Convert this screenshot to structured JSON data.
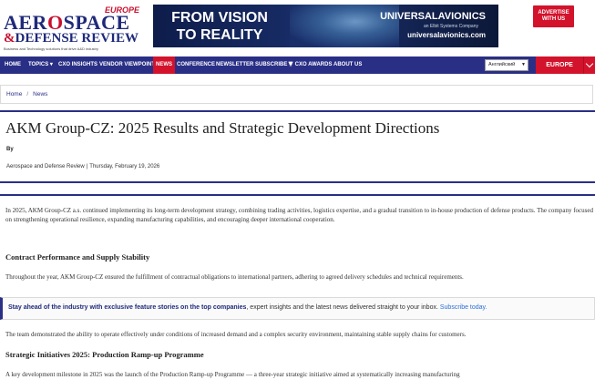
{
  "logo": {
    "edition_badge": "EUROPE",
    "line1_a": "AER",
    "line1_o": "O",
    "line1_b": "SPACE",
    "line2_amp": "&",
    "line2": "DEFENSE REVIEW",
    "tagline": "Business and Technology solutions that drive A&D industry"
  },
  "ad": {
    "headline_1": "FROM VISION",
    "headline_2": "TO REALITY",
    "brand": "UNIVERSALAVIONICS",
    "sub": "an Elbit Systems Company",
    "url": "universalavionics.com"
  },
  "advertise": {
    "line1": "ADVERTISE",
    "line2": "WITH US"
  },
  "nav": {
    "items": [
      "HOME",
      "TOPICS",
      "CXO INSIGHTS",
      "VENDOR VIEWPOINT",
      "NEWS",
      "CONFERENCE",
      "NEWSLETTER",
      "SUBSCRIBE",
      "CXO AWARDS",
      "ABOUT US"
    ],
    "topics_caret": "▾",
    "awards_icon": "trophy-icon",
    "language": "Английский",
    "language_caret": "▼",
    "edition": "EUROPE"
  },
  "breadcrumb": {
    "home": "Home",
    "sep": "/",
    "current": "News"
  },
  "article": {
    "title": "AKM Group-CZ: 2025 Results and Strategic Development Directions",
    "by": "By",
    "source": "Aerospace and Defense Review",
    "meta_sep": "|",
    "date": "Thursday, February 19, 2026",
    "p1": "In 2025, AKM Group-CZ a.s. continued implementing its long-term development strategy, combining trading activities, logistics expertise, and a gradual transition to in-house production of defense products. The company focused on strengthening operational resilience, expanding manufacturing capabilities, and encouraging deeper international cooperation.",
    "h1": "Contract Performance and Supply Stability",
    "p2": "Throughout the year, AKM Group-CZ ensured the fulfillment of contractual obligations to international partners, adhering to agreed delivery schedules and technical requirements.",
    "callout_bold": "Stay ahead of the industry with exclusive feature stories on the top companies",
    "callout_rest": ", expert insights and the latest news delivered straight to your inbox. ",
    "callout_link": "Subscribe today.",
    "p3": "The team demonstrated the ability to operate effectively under conditions of increased demand and a complex security environment, maintaining stable supply chains for customers.",
    "h2": "Strategic Initiatives 2025: Production Ramp-up Programme",
    "p4": "A key development milestone in 2025 was the launch of the Production Ramp-up Programme — a three-year strategic initiative aimed at systematically increasing manufacturing"
  },
  "colors": {
    "navy": "#2a2f86",
    "red": "#d3122b",
    "link": "#2a6fd6"
  }
}
